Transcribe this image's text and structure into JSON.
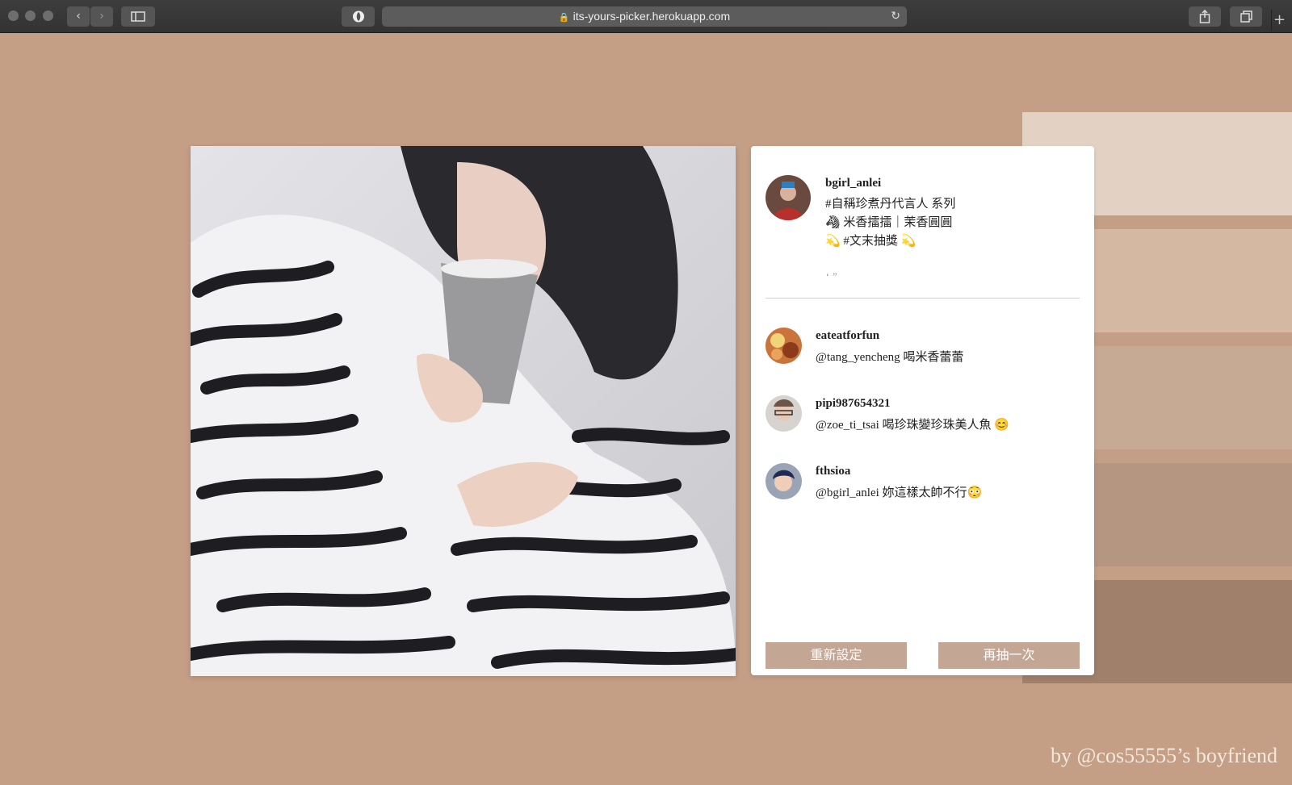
{
  "browser": {
    "url": "its-yours-picker.herokuapp.com",
    "lock_glyph": "🔒",
    "reload_glyph": "↻",
    "back_glyph": "‹",
    "forward_glyph": "›"
  },
  "post": {
    "username": "bgirl_anlei",
    "caption_lines": [
      "#自稱珍煮丹代言人 系列",
      "🦓 米香擂擂｜茉香圓圓",
      "💫 #文末抽獎 💫"
    ],
    "quote_mark": "‘ ”"
  },
  "comments": [
    {
      "username": "eateatforfun",
      "text": "@tang_yencheng 喝米香蕾蕾"
    },
    {
      "username": "pipi987654321",
      "text": "@zoe_ti_tsai 喝珍珠變珍珠美人魚 😊"
    },
    {
      "username": "fthsioa",
      "text": "@bgirl_anlei 妳這樣太帥不行😳"
    }
  ],
  "buttons": {
    "reset": "重新設定",
    "draw_again": "再抽一次"
  },
  "footer": "by @cos55555’s boyfriend",
  "colors": {
    "background": "#c49e85",
    "button": "#c4a694",
    "swatches": [
      "#e3d2c4",
      "#d5b8a1",
      "#c7aa94",
      "#b59680",
      "#a0806b"
    ]
  }
}
